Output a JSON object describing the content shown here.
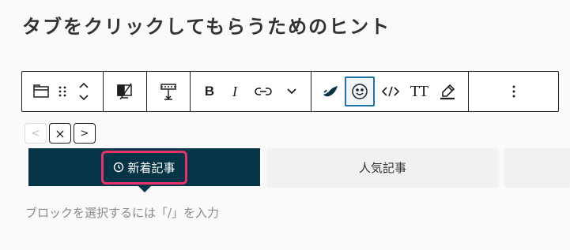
{
  "heading": "タブをクリックしてもらうためのヒント",
  "toolbar": {
    "groups": [
      [
        "tabs-block-icon",
        "drag-handle-icon",
        "move-up-down-icon"
      ],
      [
        "toggle-visibility-icon"
      ],
      [
        "align-vertical-icon"
      ],
      [
        "bold-icon",
        "italic-icon",
        "link-icon",
        "chevron-down-icon"
      ],
      [
        "highlight-icon",
        "emoji-icon",
        "code-icon",
        "text-size-icon",
        "marker-icon"
      ],
      [
        "more-options-icon"
      ]
    ],
    "bold_label": "B",
    "italic_label": "I",
    "text_size_label": "TT",
    "active_button": "emoji-icon",
    "active_color": "#2271b1"
  },
  "mini_nav": {
    "prev": "<",
    "close": "×",
    "next": ">"
  },
  "tabs": [
    {
      "label": "新着記事",
      "icon": "clock-icon",
      "active": true
    },
    {
      "label": "人気記事",
      "active": false
    },
    {
      "label": "",
      "active": false
    }
  ],
  "colors": {
    "tab_active_bg": "#053447",
    "highlight_border": "#e8336d",
    "tab_inactive_bg": "#f1f1f1"
  },
  "placeholder": "ブロックを選択するには「/」を入力"
}
